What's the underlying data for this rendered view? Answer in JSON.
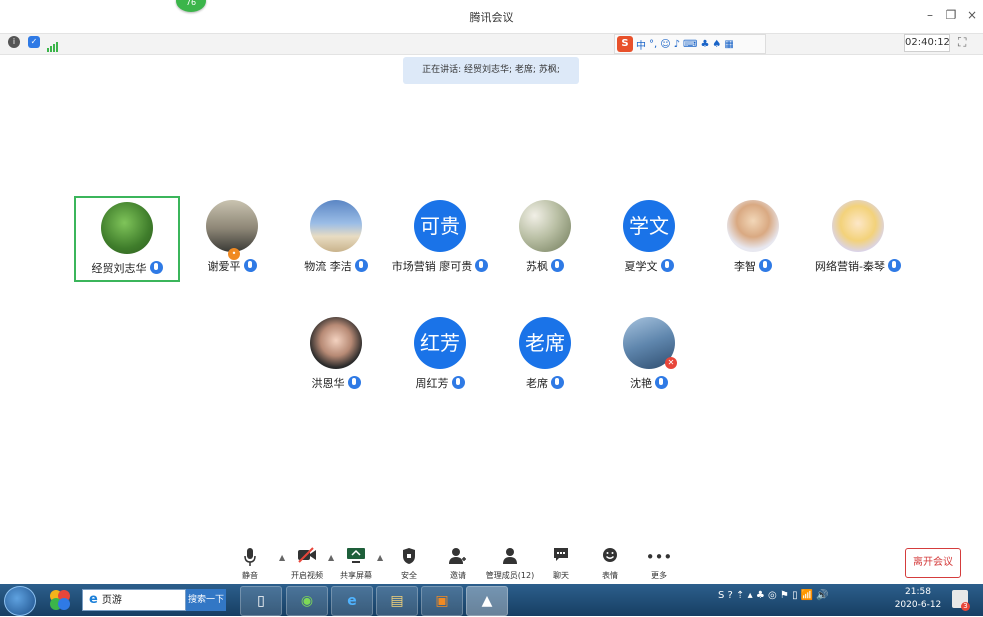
{
  "window": {
    "title": "腾讯会议",
    "badge": "76",
    "minimize_glyph": "–",
    "restore_glyph": "❐",
    "close_glyph": "×"
  },
  "status": {
    "clock": "02:40:12",
    "ime_items": [
      "S",
      "中",
      "°,",
      "☺",
      "♪",
      "⌨",
      "♣",
      "♠",
      "▦"
    ]
  },
  "speaking": "正在讲话: 经贸刘志华; 老席; 苏枫;",
  "participants": [
    {
      "name": "经贸刘志华",
      "avatar": "photo-green",
      "active": true
    },
    {
      "name": "谢爱平",
      "avatar": "photo-dusk",
      "active": false
    },
    {
      "name": "物流  李洁",
      "avatar": "photo-beach",
      "active": false
    },
    {
      "name": "市场营销  廖可贵",
      "avatar": "可贵",
      "active": false
    },
    {
      "name": "苏枫",
      "avatar": "photo-flowers",
      "active": false
    },
    {
      "name": "夏学文",
      "avatar": "学文",
      "active": false
    },
    {
      "name": "李智",
      "avatar": "photo-boy",
      "active": false
    },
    {
      "name": "网络营销-秦琴",
      "avatar": "photo-anime",
      "active": false
    },
    {
      "name": "洪恩华",
      "avatar": "photo-woman",
      "active": false
    },
    {
      "name": "周红芳",
      "avatar": "红芳",
      "active": false
    },
    {
      "name": "老席",
      "avatar": "老席",
      "active": false
    },
    {
      "name": "沈艳",
      "avatar": "photo-sky",
      "active": false
    }
  ],
  "toolbar": {
    "mute": "静音",
    "video": "开启视频",
    "share": "共享屏幕",
    "security": "安全",
    "invite": "邀请",
    "members": "管理成员(12)",
    "chat": "聊天",
    "emoji": "表情",
    "more": "更多",
    "leave": "离开会议"
  },
  "taskbar": {
    "address": "页游",
    "search": "搜索一下",
    "time": "21:58",
    "date": "2020-6-12"
  },
  "colors": {
    "accent": "#1a73e8",
    "active_border": "#3bb55b",
    "leave": "#d43c3c",
    "banner": "#dde9f8"
  }
}
